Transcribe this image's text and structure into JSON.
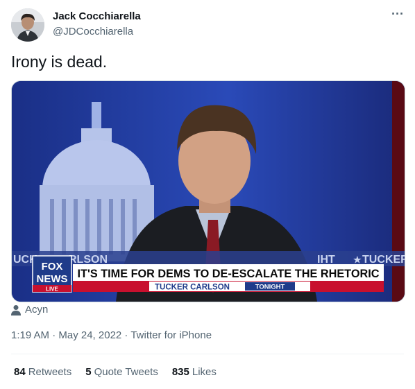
{
  "author": {
    "display_name": "Jack Cocchiarella",
    "handle": "@JDCocchiarella"
  },
  "more_icon": "more-horizontal-icon",
  "tweet": {
    "text": "Irony is dead."
  },
  "media": {
    "banner_text": "IT'S TIME FOR DEMS TO DE-ESCALATE THE RHETORIC",
    "show_name": "TUCKER CARLSON",
    "show_suffix": "TONIGHT",
    "network_line1": "FOX",
    "network_line2": "NEWS",
    "network_live": "LIVE",
    "ticker_left": "UCK",
    "ticker_left2": "RLSON",
    "ticker_right": "IHT",
    "ticker_right2": "TUCKER"
  },
  "attribution": {
    "icon": "person-icon",
    "name": "Acyn"
  },
  "meta": {
    "timestamp": "1:19 AM · May 24, 2022 · Twitter for iPhone"
  },
  "stats": {
    "retweets_count": "84",
    "retweets_label": "Retweets",
    "quotes_count": "5",
    "quotes_label": "Quote Tweets",
    "likes_count": "835",
    "likes_label": "Likes"
  },
  "colors": {
    "text_primary": "#0f1419",
    "text_secondary": "#536471",
    "fox_red": "#c8102e",
    "fox_blue": "#1f3b8a"
  }
}
